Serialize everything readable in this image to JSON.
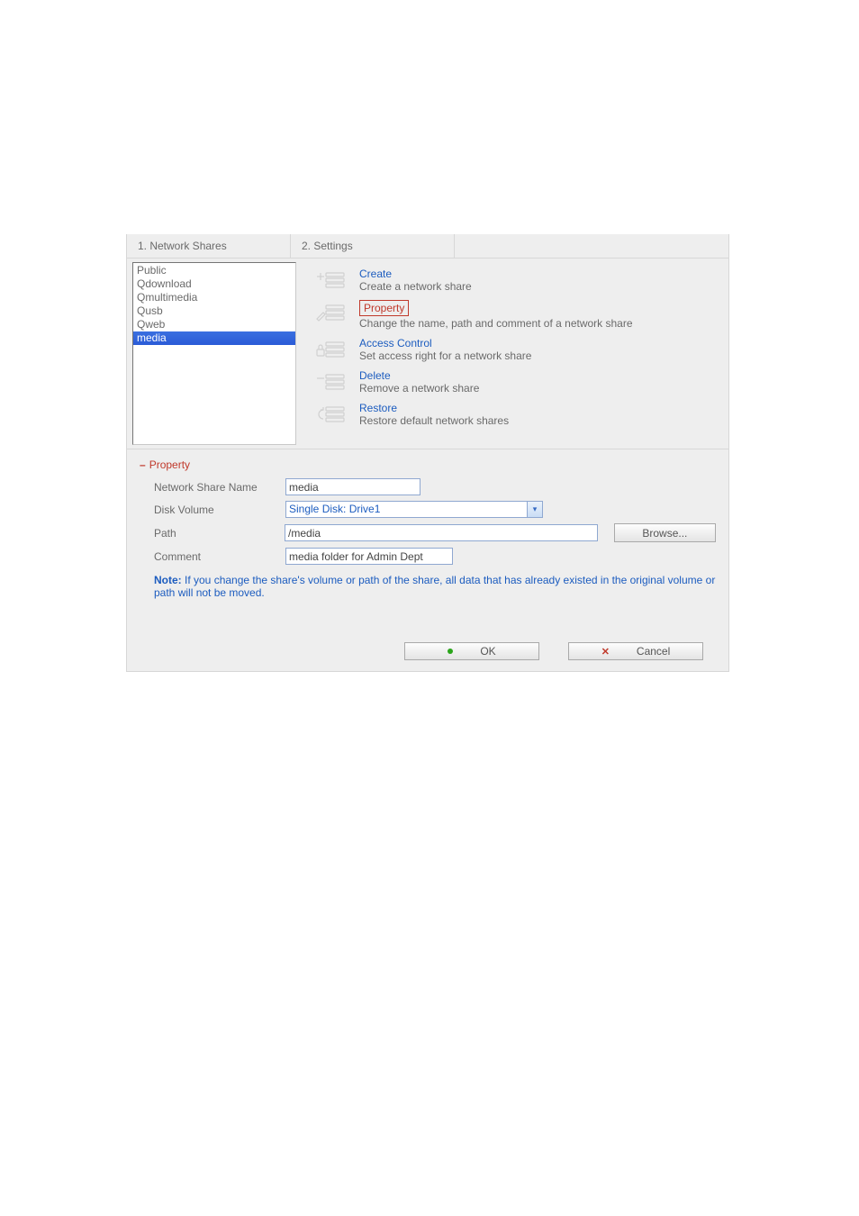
{
  "tabs": {
    "network_shares": "1. Network Shares",
    "settings": "2. Settings"
  },
  "share_list": {
    "items": [
      {
        "label": "Public"
      },
      {
        "label": "Qdownload"
      },
      {
        "label": "Qmultimedia"
      },
      {
        "label": "Qusb"
      },
      {
        "label": "Qweb"
      },
      {
        "label": "media"
      }
    ],
    "selected_index": 5
  },
  "actions": {
    "create": {
      "title": "Create",
      "desc": "Create a network share"
    },
    "property": {
      "title": "Property",
      "desc": "Change the name, path and comment of a network share"
    },
    "access_control": {
      "title": "Access Control",
      "desc": "Set access right for a network share"
    },
    "delete": {
      "title": "Delete",
      "desc": "Remove a network share"
    },
    "restore": {
      "title": "Restore",
      "desc": "Restore default network shares"
    }
  },
  "property_section": {
    "header": "Property",
    "labels": {
      "name": "Network Share Name",
      "disk_volume": "Disk Volume",
      "path": "Path",
      "comment": "Comment"
    },
    "values": {
      "name": "media",
      "disk_volume": "Single Disk: Drive1",
      "path": "/media",
      "comment": "media folder for Admin Dept"
    },
    "browse_label": "Browse...",
    "note_bold": "Note:",
    "note_text": " If you change the share's volume or path of the share, all data that has already existed in the original volume or path will not be moved."
  },
  "buttons": {
    "ok": "OK",
    "cancel": "Cancel"
  }
}
